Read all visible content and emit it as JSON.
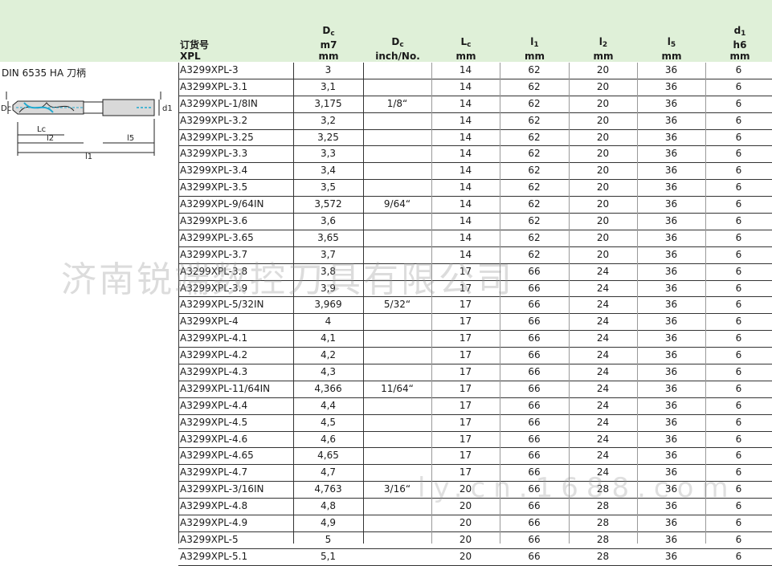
{
  "header": {
    "order_no": [
      "订货号",
      "XPL"
    ],
    "dc_metric": [
      "D",
      "c",
      "m7",
      "mm"
    ],
    "dc_inch": [
      "D",
      "c",
      "inch/No."
    ],
    "lc": [
      "L",
      "c",
      "mm"
    ],
    "l1": [
      "l",
      "1",
      "mm"
    ],
    "l2": [
      "l",
      "2",
      "mm"
    ],
    "l5": [
      "l",
      "5",
      "mm"
    ],
    "d1": [
      "d",
      "1",
      "h6",
      "mm"
    ]
  },
  "spec_label": "DIN 6535 HA 刀柄",
  "diagram_labels": {
    "dc": "Dc",
    "d1": "d1",
    "lc": "Lc",
    "l2": "l2",
    "l5": "l5",
    "l1": "l1"
  },
  "rows": [
    [
      "A3299XPL-3",
      "3",
      "",
      "14",
      "62",
      "20",
      "36",
      "6"
    ],
    [
      "A3299XPL-3.1",
      "3,1",
      "",
      "14",
      "62",
      "20",
      "36",
      "6"
    ],
    [
      "A3299XPL-1/8IN",
      "3,175",
      "1/8“",
      "14",
      "62",
      "20",
      "36",
      "6"
    ],
    [
      "A3299XPL-3.2",
      "3,2",
      "",
      "14",
      "62",
      "20",
      "36",
      "6"
    ],
    [
      "A3299XPL-3.25",
      "3,25",
      "",
      "14",
      "62",
      "20",
      "36",
      "6"
    ],
    [
      "A3299XPL-3.3",
      "3,3",
      "",
      "14",
      "62",
      "20",
      "36",
      "6"
    ],
    [
      "A3299XPL-3.4",
      "3,4",
      "",
      "14",
      "62",
      "20",
      "36",
      "6"
    ],
    [
      "A3299XPL-3.5",
      "3,5",
      "",
      "14",
      "62",
      "20",
      "36",
      "6"
    ],
    [
      "A3299XPL-9/64IN",
      "3,572",
      "9/64“",
      "14",
      "62",
      "20",
      "36",
      "6"
    ],
    [
      "A3299XPL-3.6",
      "3,6",
      "",
      "14",
      "62",
      "20",
      "36",
      "6"
    ],
    [
      "A3299XPL-3.65",
      "3,65",
      "",
      "14",
      "62",
      "20",
      "36",
      "6"
    ],
    [
      "A3299XPL-3.7",
      "3,7",
      "",
      "14",
      "62",
      "20",
      "36",
      "6"
    ],
    [
      "A3299XPL-3.8",
      "3,8",
      "",
      "17",
      "66",
      "24",
      "36",
      "6"
    ],
    [
      "A3299XPL-3.9",
      "3,9",
      "",
      "17",
      "66",
      "24",
      "36",
      "6"
    ],
    [
      "A3299XPL-5/32IN",
      "3,969",
      "5/32“",
      "17",
      "66",
      "24",
      "36",
      "6"
    ],
    [
      "A3299XPL-4",
      "4",
      "",
      "17",
      "66",
      "24",
      "36",
      "6"
    ],
    [
      "A3299XPL-4.1",
      "4,1",
      "",
      "17",
      "66",
      "24",
      "36",
      "6"
    ],
    [
      "A3299XPL-4.2",
      "4,2",
      "",
      "17",
      "66",
      "24",
      "36",
      "6"
    ],
    [
      "A3299XPL-4.3",
      "4,3",
      "",
      "17",
      "66",
      "24",
      "36",
      "6"
    ],
    [
      "A3299XPL-11/64IN",
      "4,366",
      "11/64“",
      "17",
      "66",
      "24",
      "36",
      "6"
    ],
    [
      "A3299XPL-4.4",
      "4,4",
      "",
      "17",
      "66",
      "24",
      "36",
      "6"
    ],
    [
      "A3299XPL-4.5",
      "4,5",
      "",
      "17",
      "66",
      "24",
      "36",
      "6"
    ],
    [
      "A3299XPL-4.6",
      "4,6",
      "",
      "17",
      "66",
      "24",
      "36",
      "6"
    ],
    [
      "A3299XPL-4.65",
      "4,65",
      "",
      "17",
      "66",
      "24",
      "36",
      "6"
    ],
    [
      "A3299XPL-4.7",
      "4,7",
      "",
      "17",
      "66",
      "24",
      "36",
      "6"
    ],
    [
      "A3299XPL-3/16IN",
      "4,763",
      "3/16“",
      "20",
      "66",
      "28",
      "36",
      "6"
    ],
    [
      "A3299XPL-4.8",
      "4,8",
      "",
      "20",
      "66",
      "28",
      "36",
      "6"
    ],
    [
      "A3299XPL-4.9",
      "4,9",
      "",
      "20",
      "66",
      "28",
      "36",
      "6"
    ],
    [
      "A3299XPL-5",
      "5",
      "",
      "20",
      "66",
      "28",
      "36",
      "6"
    ],
    [
      "A3299XPL-5.1",
      "5,1",
      "",
      "20",
      "66",
      "28",
      "36",
      "6"
    ]
  ],
  "watermark": "济南锐端数控刀具有限公司",
  "watermark2": "ly.cn.1688.com"
}
